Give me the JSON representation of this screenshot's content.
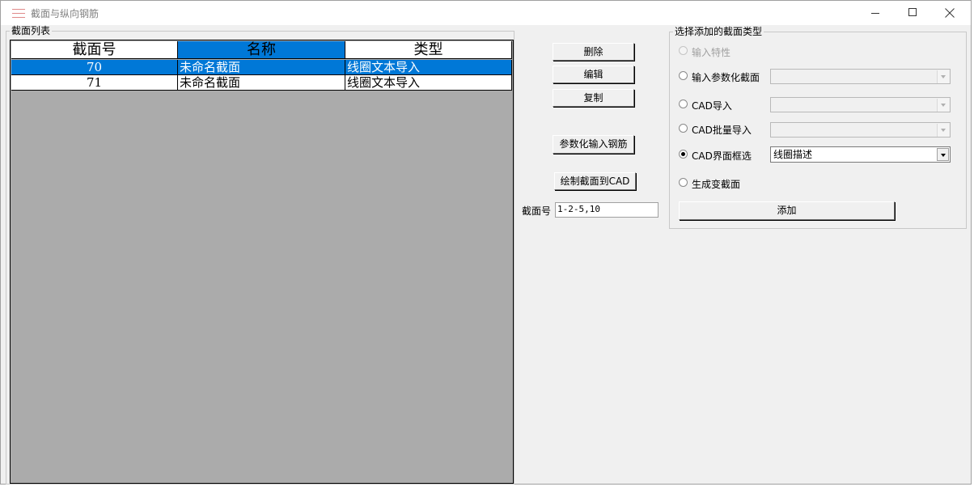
{
  "window": {
    "title": "截面与纵向钢筋"
  },
  "list_panel": {
    "legend": "截面列表",
    "columns": [
      "截面号",
      "名称",
      "类型"
    ],
    "rows": [
      {
        "id": "70",
        "name": "未命名截面",
        "type": "线圈文本导入"
      },
      {
        "id": "71",
        "name": "未命名截面",
        "type": "线圈文本导入"
      }
    ]
  },
  "actions": {
    "delete": "删除",
    "edit": "编辑",
    "copy": "复制",
    "param_rebar": "参数化输入钢筋",
    "draw_cad": "绘制截面到CAD",
    "section_no_label": "截面号",
    "section_no_value": "1-2-5,10"
  },
  "add_panel": {
    "legend": "选择添加的截面类型",
    "options": [
      {
        "label": "输入特性"
      },
      {
        "label": "输入参数化截面"
      },
      {
        "label": "CAD导入"
      },
      {
        "label": "CAD批量导入"
      },
      {
        "label": "CAD界面框选",
        "combo_value": "线圈描述"
      },
      {
        "label": "生成变截面"
      }
    ],
    "add_button": "添加"
  },
  "colors": {
    "selection": "#0078d7",
    "grid_background": "#ababab",
    "window_background": "#f0f0f0"
  }
}
